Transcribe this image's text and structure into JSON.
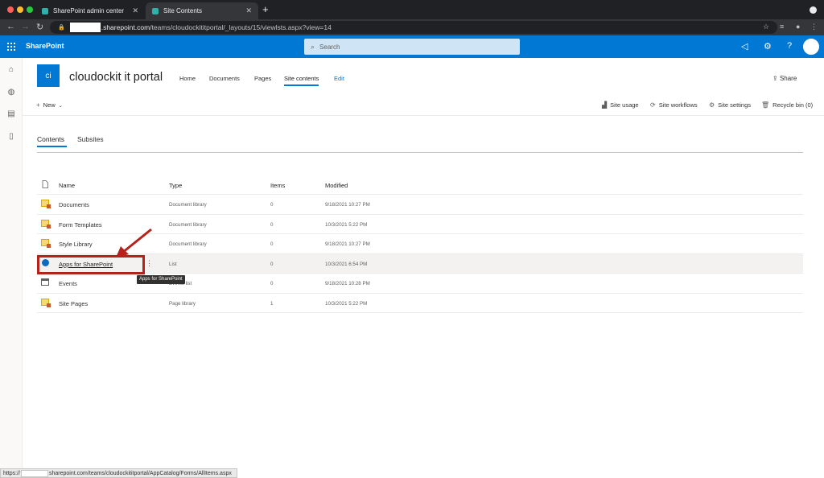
{
  "browser": {
    "tabs": [
      {
        "title": "SharePoint admin center"
      },
      {
        "title": "Site Contents"
      }
    ],
    "url_host_suffix": ".sharepoint.com",
    "url_path": "/teams/cloudockititportal/_layouts/15/viewlsts.aspx?view=14",
    "new_tab_glyph": "+"
  },
  "suitebar": {
    "brand": "SharePoint",
    "search_placeholder": "Search",
    "accent": "#0078d4"
  },
  "site": {
    "logo_text": "ci",
    "title": "cloudockit it portal",
    "nav": [
      "Home",
      "Documents",
      "Pages",
      "Site contents",
      "Edit"
    ],
    "share_label": "Share"
  },
  "commands": {
    "new_label": "New",
    "site_usage": "Site usage",
    "site_workflows": "Site workflows",
    "site_settings": "Site settings",
    "recycle_bin": "Recycle bin (0)"
  },
  "pivots": {
    "contents": "Contents",
    "subsites": "Subsites"
  },
  "table": {
    "columns": {
      "name": "Name",
      "type": "Type",
      "items": "Items",
      "modified": "Modified"
    },
    "rows": [
      {
        "name": "Documents",
        "type": "Document library",
        "items": "0",
        "modified": "9/18/2021 10:27 PM",
        "icon": "library-icon"
      },
      {
        "name": "Form Templates",
        "type": "Document library",
        "items": "0",
        "modified": "10/3/2021 5:22 PM",
        "icon": "library-icon"
      },
      {
        "name": "Style Library",
        "type": "Document library",
        "items": "0",
        "modified": "9/18/2021 10:27 PM",
        "icon": "library-icon"
      },
      {
        "name": "Apps for SharePoint",
        "type": "List",
        "items": "0",
        "modified": "10/3/2021 6:54 PM",
        "icon": "app-catalog-icon"
      },
      {
        "name": "Events",
        "type": "Events list",
        "items": "0",
        "modified": "9/18/2021 10:28 PM",
        "icon": "calendar-icon"
      },
      {
        "name": "Site Pages",
        "type": "Page library",
        "items": "1",
        "modified": "10/3/2021 5:22 PM",
        "icon": "library-icon"
      }
    ]
  },
  "tooltip": "Apps for SharePoint",
  "status_bar": {
    "prefix": "https://",
    "suffix": "sharepoint.com/teams/cloudockititportal/AppCatalog/Forms/AllItems.aspx"
  },
  "annotation_color": "#b5221b"
}
